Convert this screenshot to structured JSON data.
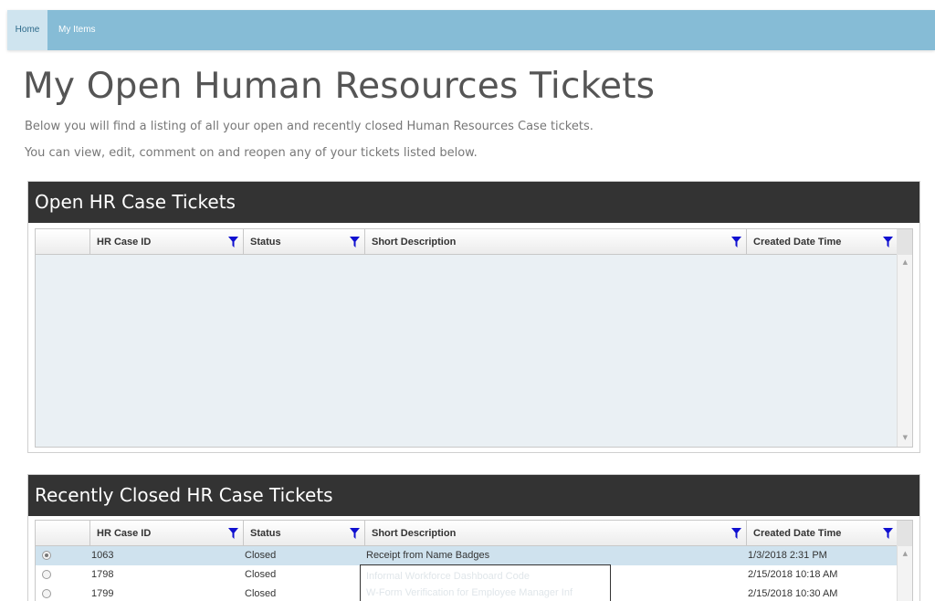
{
  "nav": {
    "home": "Home",
    "my_items": "My Items"
  },
  "page": {
    "title": "My Open Human Resources Tickets",
    "intro_line1": "Below you will find a listing of all your open and recently closed Human Resources Case tickets.",
    "intro_line2": "You can view, edit, comment on and reopen any of your tickets listed below."
  },
  "open_panel": {
    "title": "Open HR Case Tickets",
    "columns": [
      "HR Case ID",
      "Status",
      "Short Description",
      "Created Date Time"
    ],
    "rows": []
  },
  "closed_panel": {
    "title": "Recently Closed HR Case Tickets",
    "columns": [
      "HR Case ID",
      "Status",
      "Short Description",
      "Created Date Time"
    ],
    "rows": [
      {
        "id": "1063",
        "status": "Closed",
        "description": "Receipt from Name Badges",
        "created": "1/3/2018 2:31 PM",
        "selected": true
      },
      {
        "id": "1798",
        "status": "Closed",
        "description": "",
        "created": "2/15/2018 10:18 AM",
        "selected": false
      },
      {
        "id": "1799",
        "status": "Closed",
        "description": "",
        "created": "2/15/2018 10:30 AM",
        "selected": false
      }
    ]
  },
  "popup": {
    "line1": "Informal Workforce Dashboard Code",
    "line2": "W-Form Verification for Employee Manager Inf"
  },
  "colors": {
    "topbar": "#86bcd6",
    "panel_header": "#333333",
    "filter_icon": "#1010d0",
    "selected_row": "#cfe2ee"
  },
  "icons": {
    "filter": "filter-funnel-icon",
    "radio": "radio-button-icon"
  }
}
